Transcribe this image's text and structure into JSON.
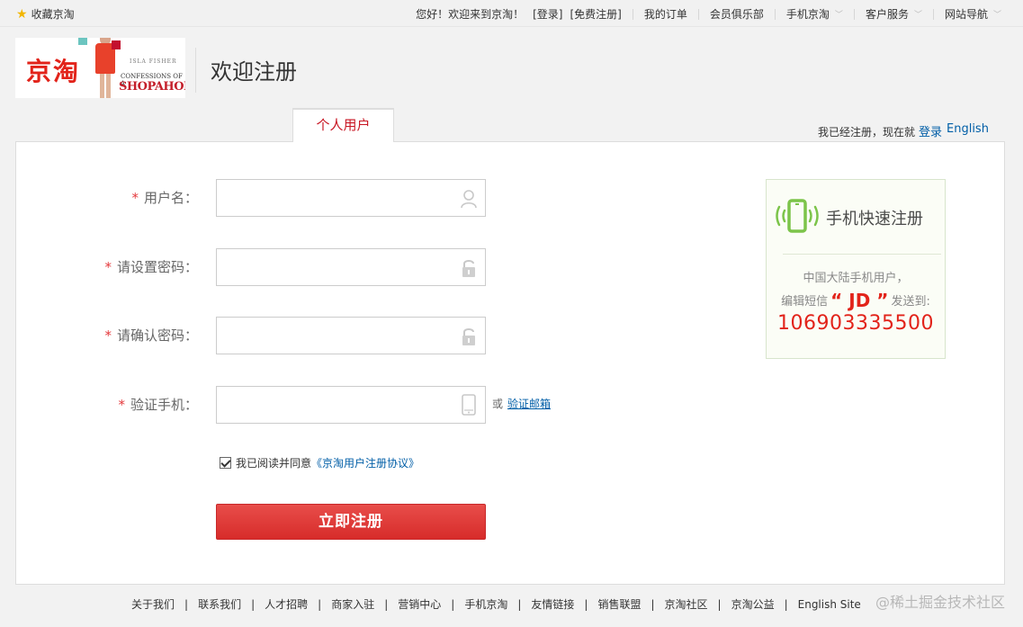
{
  "topbar": {
    "favorite": "收藏京淘",
    "greeting": "您好！欢迎来到京淘！",
    "login": "[登录]",
    "register": "[免费注册]",
    "my_orders": "我的订单",
    "member_club": "会员俱乐部",
    "mobile_jingtao": "手机京淘",
    "customer_service": "客户服务",
    "site_nav": "网站导航"
  },
  "header": {
    "logo_text": "京淘",
    "logo_sub1": "ISLA FISHER",
    "logo_sub2": "CONFESSIONS OF A",
    "logo_sub3": "SHOPAHOLIC",
    "title": "欢迎注册"
  },
  "tabs": {
    "personal": "个人用户",
    "already_registered": "我已经注册，现在就",
    "login_link": "登录",
    "english": "English"
  },
  "form": {
    "required_mark": "*",
    "username_label": "用户名：",
    "password_label": "请设置密码：",
    "confirm_label": "请确认密码：",
    "phone_label": "验证手机：",
    "or_text": "或",
    "verify_email": "验证邮箱",
    "agree_text": "我已阅读并同意",
    "agreement_link": "《京淘用户注册协议》",
    "submit": "立即注册"
  },
  "mobile_box": {
    "title": "手机快速注册",
    "line1": "中国大陆手机用户，",
    "line2_pre": "编辑短信",
    "line2_code": "“ JD ”",
    "line2_post": "发送到:",
    "number": "106903335500"
  },
  "footer": {
    "links": [
      "关于我们",
      "联系我们",
      "人才招聘",
      "商家入驻",
      "营销中心",
      "手机京淘",
      "友情链接",
      "销售联盟",
      "京淘社区",
      "京淘公益",
      "English Site"
    ],
    "separator": "|"
  },
  "watermark": {
    "text": "@稀土掘金技术社区"
  },
  "colors": {
    "brand_red": "#e2231a",
    "link_blue": "#005ea7",
    "submit_red": "#d72c2a"
  }
}
